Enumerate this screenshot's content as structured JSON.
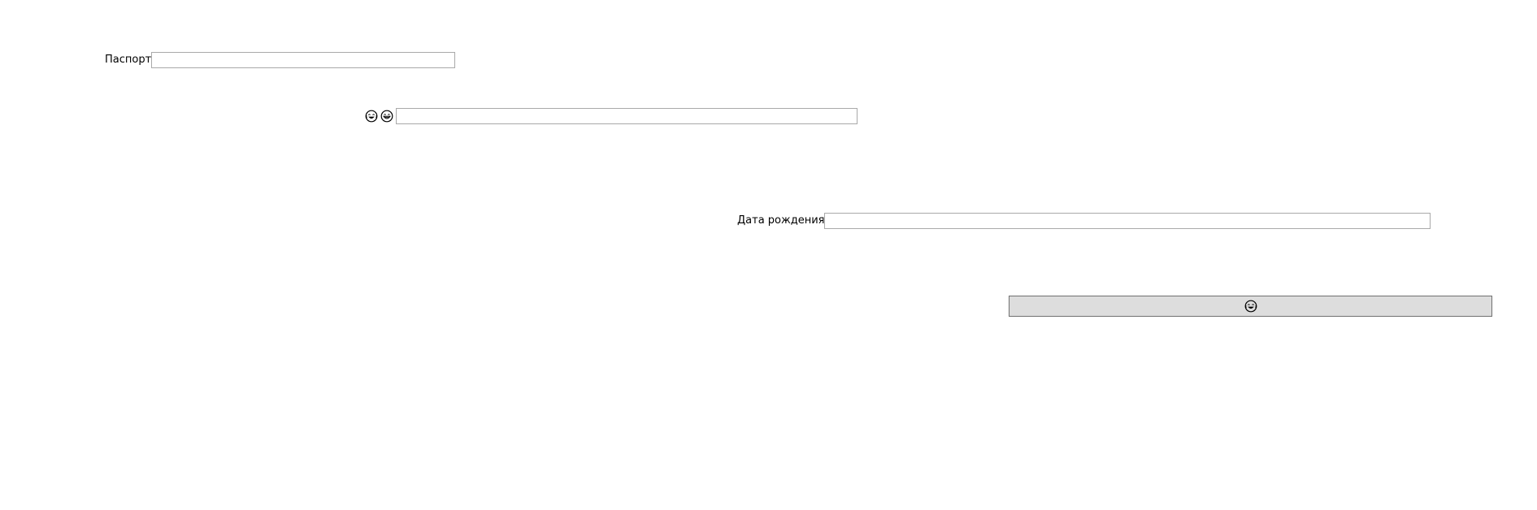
{
  "form": {
    "passport": {
      "label": "Паспорт",
      "value": "",
      "placeholder": ""
    },
    "emoji_field": {
      "icons": [
        "laughing-tears-face-icon",
        "grinning-face-icon"
      ],
      "value": "",
      "placeholder": ""
    },
    "birth_date": {
      "label": "Дата рождения",
      "value": "",
      "placeholder": ""
    },
    "submit": {
      "icon": "laughing-tears-face-icon"
    }
  }
}
